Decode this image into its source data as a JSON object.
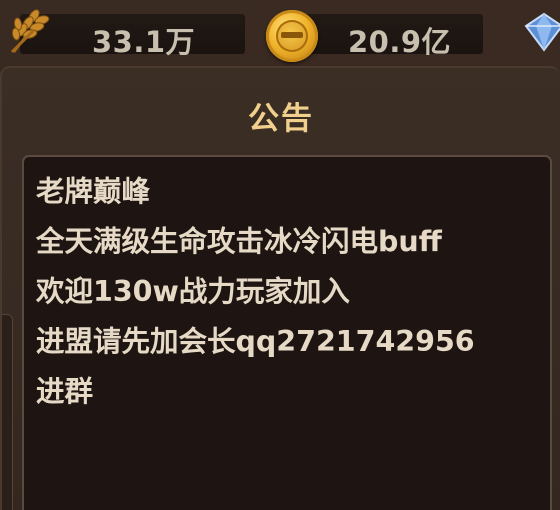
{
  "resources": {
    "wheat_value": "33.1万",
    "gold_value": "20.9亿"
  },
  "announcement": {
    "title": "公告",
    "lines": [
      "老牌巅峰",
      "全天满级生命攻击冰冷闪电buff",
      "欢迎130w战力玩家加入",
      "进盟请先加会长qq2721742956",
      "进群"
    ]
  },
  "icons": {
    "wheat": "wheat-icon",
    "gold": "gold-coin-icon",
    "gem": "diamond-icon"
  },
  "colors": {
    "title": "#f1cf8c",
    "text": "#e6dac6",
    "resource_text": "#c9bfae"
  }
}
